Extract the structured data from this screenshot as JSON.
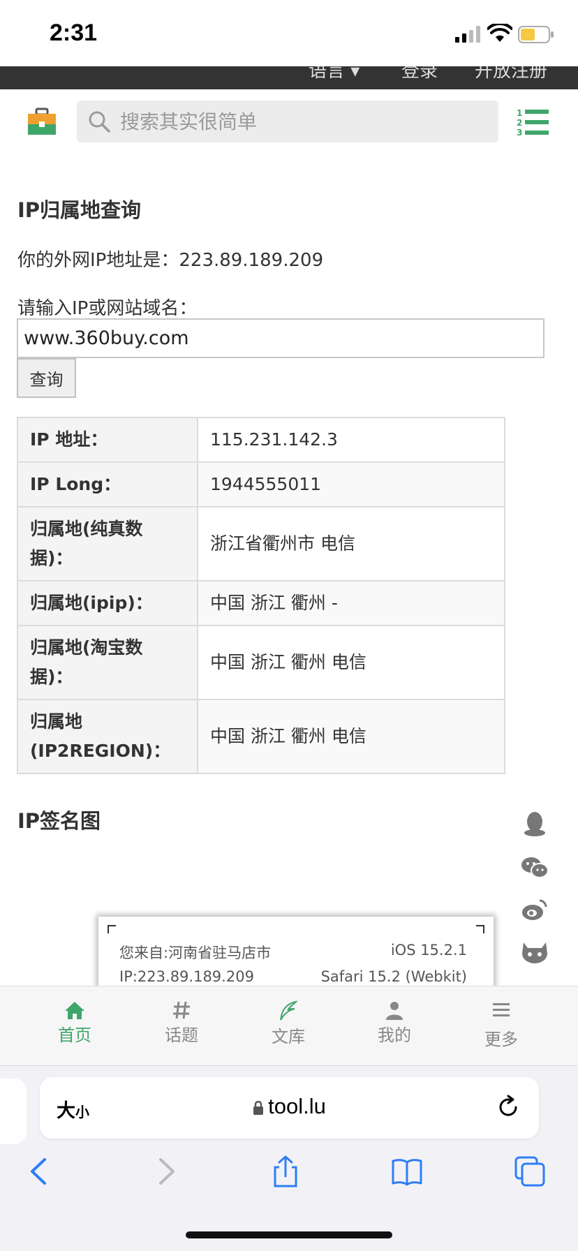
{
  "status_bar": {
    "time": "2:31"
  },
  "site_nav": {
    "items": [
      "语言 ▾",
      "登录",
      "开放注册"
    ]
  },
  "header": {
    "search_placeholder": "搜索其实很简单"
  },
  "main": {
    "title": "IP归属地查询",
    "your_ip_label": "你的外网IP地址是：",
    "your_ip": "223.89.189.209",
    "input_label": "请输入IP或网站域名：",
    "input_value": "www.360buy.com",
    "query_button": "查询"
  },
  "result_table": [
    {
      "key": "IP 地址：",
      "value": "115.231.142.3"
    },
    {
      "key": "IP Long：",
      "value": "1944555011"
    },
    {
      "key": "归属地(纯真数据)：",
      "value": "浙江省衢州市 电信"
    },
    {
      "key": "归属地(ipip)：",
      "value": "中国 浙江 衢州 -"
    },
    {
      "key": "归属地(淘宝数据)：",
      "value": "中国 浙江 衢州 电信"
    },
    {
      "key": "归属地(IP2REGION)：",
      "value": "中国 浙江 衢州 电信"
    }
  ],
  "signature": {
    "title": "IP签名图",
    "from_text": "您来自:河南省驻马店市",
    "os_text": "iOS 15.2.1",
    "ip_text": "IP:223.89.189.209",
    "browser_text": "Safari 15.2 (Webkit)"
  },
  "side_icons": [
    "qq-icon",
    "wechat-icon",
    "weibo-icon",
    "github-icon"
  ],
  "tabbar": {
    "items": [
      {
        "label": "首页",
        "icon": "home-icon",
        "active": true
      },
      {
        "label": "话题",
        "icon": "hash-icon",
        "active": false
      },
      {
        "label": "文库",
        "icon": "quill-icon",
        "active": false
      },
      {
        "label": "我的",
        "icon": "user-icon",
        "active": false
      },
      {
        "label": "更多",
        "icon": "more-icon",
        "active": false
      }
    ]
  },
  "safari": {
    "text_size_big": "大",
    "text_size_small": "小",
    "url": "tool.lu"
  },
  "colors": {
    "accent_green": "#3fa66a",
    "dark_nav": "#333333"
  }
}
